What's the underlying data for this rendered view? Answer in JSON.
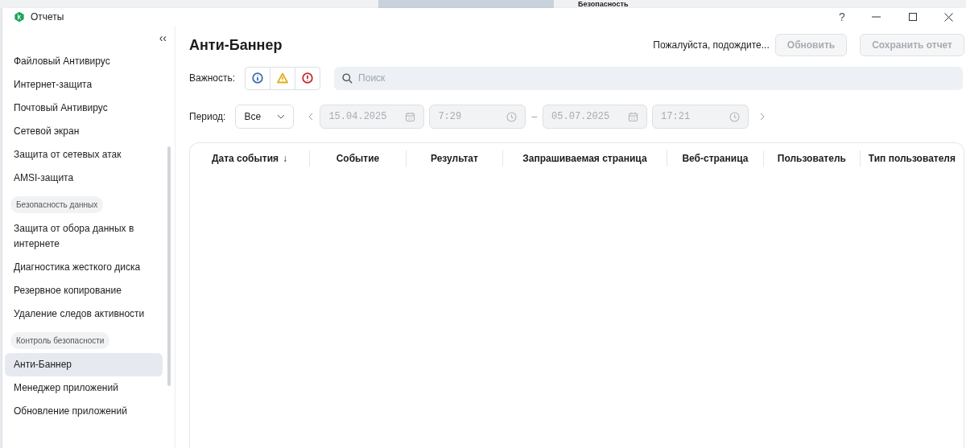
{
  "background_window": {
    "title": "Безопасность"
  },
  "window": {
    "title": "Отчеты",
    "controls": [
      "?"
    ]
  },
  "sidebar": {
    "collapse": "‹‹",
    "items": [
      {
        "kind": "item",
        "label": "Файловый Антивирус",
        "selected": false
      },
      {
        "kind": "item",
        "label": "Интернет-защита",
        "selected": false
      },
      {
        "kind": "item",
        "label": "Почтовый Антивирус",
        "selected": false
      },
      {
        "kind": "item",
        "label": "Сетевой экран",
        "selected": false
      },
      {
        "kind": "item",
        "label": "Защита от сетевых атак",
        "selected": false
      },
      {
        "kind": "item",
        "label": "AMSI-защита",
        "selected": false
      },
      {
        "kind": "group",
        "label": "Безопасность данных"
      },
      {
        "kind": "item",
        "label": "Защита от обора данных в интернете",
        "selected": false
      },
      {
        "kind": "item",
        "label": "Диагностика жесткого диска",
        "selected": false
      },
      {
        "kind": "item",
        "label": "Резервное копирование",
        "selected": false
      },
      {
        "kind": "item",
        "label": "Удаление следов активности",
        "selected": false
      },
      {
        "kind": "group",
        "label": "Контроль безопасности"
      },
      {
        "kind": "item",
        "label": "Анти-Баннер",
        "selected": true
      },
      {
        "kind": "item",
        "label": "Менеджер приложений",
        "selected": false
      },
      {
        "kind": "item",
        "label": "Обновление приложений",
        "selected": false
      }
    ]
  },
  "header": {
    "title": "Анти-Баннер",
    "status": "Пожалуйста, подождите...",
    "buttons": [
      {
        "label": "Обновить",
        "disabled": true
      },
      {
        "label": "Сохранить отчет",
        "disabled": true
      }
    ]
  },
  "filters": {
    "importance_label": "Важность:",
    "importance": [
      {
        "kind": "info",
        "color": "#3b6db3"
      },
      {
        "kind": "warning",
        "color": "#e0b020"
      },
      {
        "kind": "error",
        "color": "#c62828"
      }
    ],
    "search": {
      "placeholder": "Поиск"
    },
    "period_label": "Период:",
    "period": "Все",
    "from_date": "15.04.2025",
    "from_time": "7:29",
    "separator": "–",
    "to_date": "05.07.2025",
    "to_time": "17:21"
  },
  "table": {
    "columns": [
      {
        "label": "Дата события",
        "sort": "↓"
      },
      {
        "label": "Событие"
      },
      {
        "label": "Результат"
      },
      {
        "label": "Запрашиваемая страница"
      },
      {
        "label": "Веб-страница"
      },
      {
        "label": "Пользователь"
      },
      {
        "label": "Тип пользователя"
      }
    ]
  }
}
